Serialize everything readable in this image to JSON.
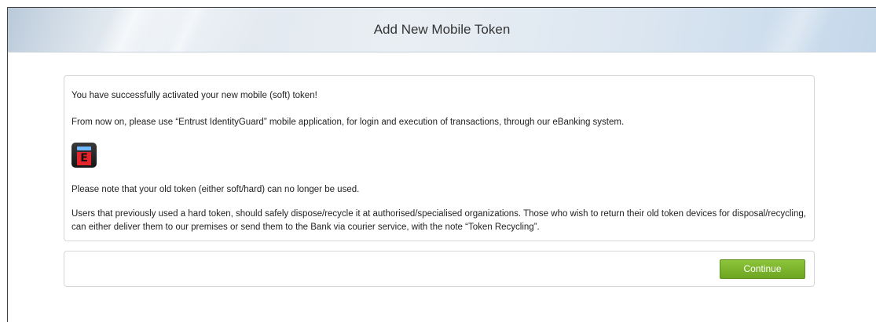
{
  "header": {
    "title": "Add New Mobile Token"
  },
  "message": {
    "line1": "You have successfully activated your new mobile (soft) token!",
    "line2": "From now on, please use “Entrust IdentityGuard” mobile application, for login and execution of transactions, through our eBanking system.",
    "app_icon": "entrust-identityguard-app-icon",
    "line3": "Please note that your old token (either soft/hard) can no longer be used.",
    "line4": "Users that previously used a hard token, should safely dispose/recycle it at authorised/specialised organizations. Those who wish to return their old token devices for disposal/recycling, can either deliver them to our premises or send them to the Bank via courier service, with the note “Token Recycling”."
  },
  "actions": {
    "continue_label": "Continue",
    "continue_color": "#7cb62e"
  }
}
